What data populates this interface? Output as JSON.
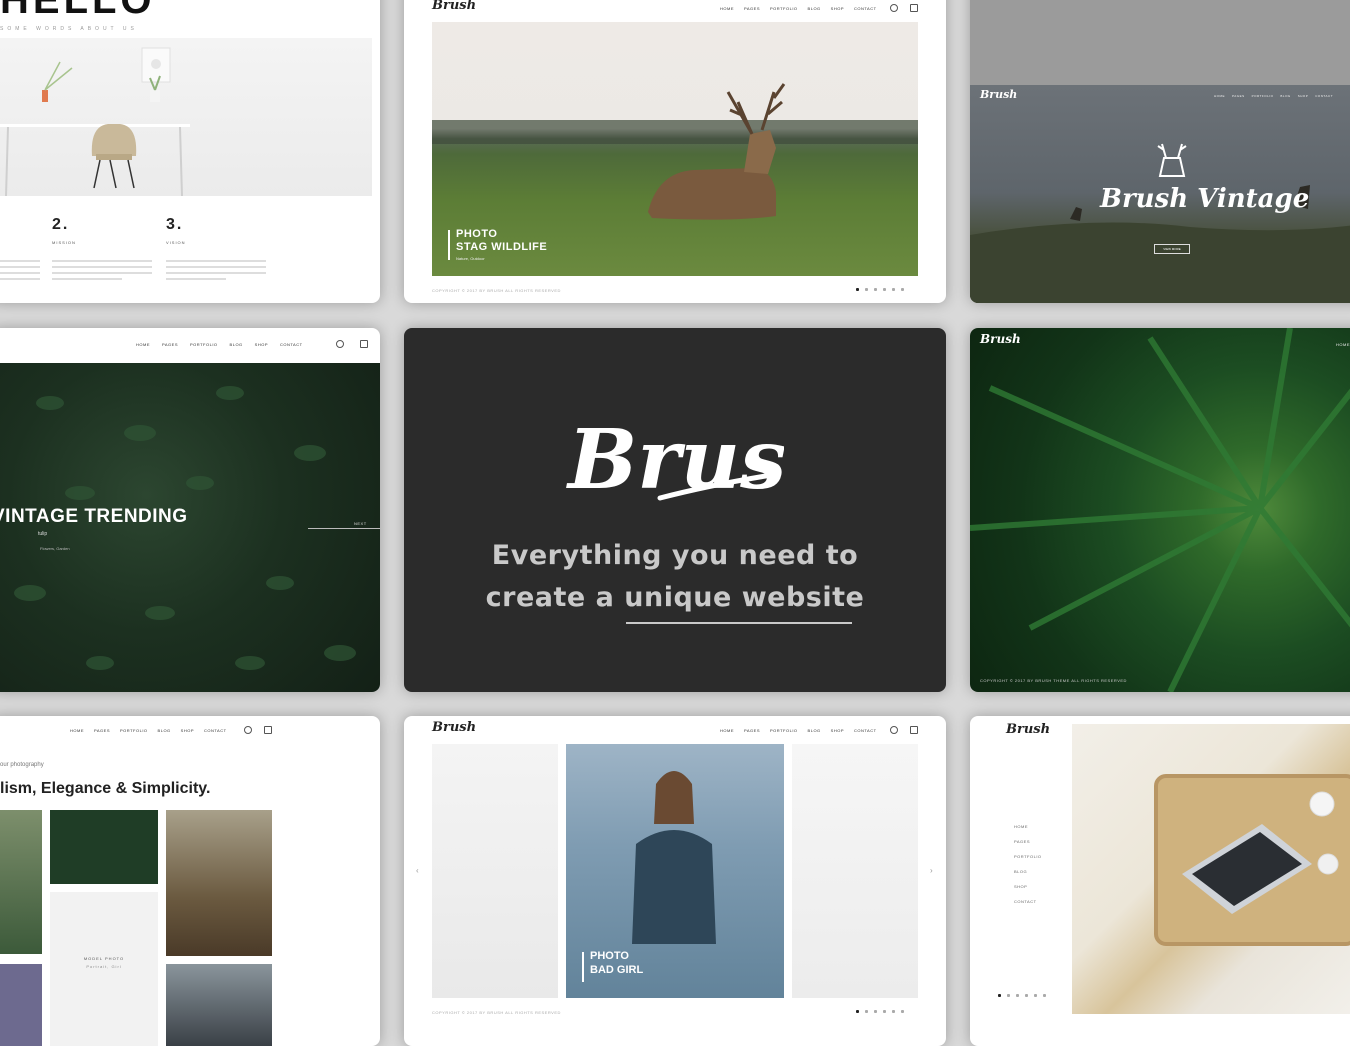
{
  "nav": {
    "items": [
      "HOME",
      "PAGES",
      "PORTFOLIO",
      "BLOG",
      "SHOP",
      "CONTACT"
    ],
    "short_items": [
      "HOME",
      "PAGES",
      "PORTFOLIO",
      "BLOG"
    ]
  },
  "logo_small": "Brush",
  "card1": {
    "headline": "HELLO",
    "subline": "SOME WORDS ABOUT US",
    "col2_number": "2.",
    "col2_label": "MISSION",
    "col3_number": "3.",
    "col3_label": "VISION"
  },
  "card2": {
    "photo_title_1": "PHOTO",
    "photo_title_2": "STAG WILDLIFE",
    "photo_sub": "Nature, Outdoor",
    "copyright": "COPYRIGHT © 2017 BY BRUSH ALL RIGHTS RESERVED"
  },
  "card3": {
    "title": "Brush Vintage",
    "button": "VIEW MORE"
  },
  "card4": {
    "title": "VINTAGE TRENDING",
    "sub": "tulip",
    "sub2": "Flowers, Garden",
    "side_link": "NEXT"
  },
  "center": {
    "logo": "Brush",
    "tagline_line1": "Everything you need to",
    "tagline_line2": "create a unique website"
  },
  "card6": {
    "nav_label": "HOME",
    "copyright": "COPYRIGHT © 2017 BY BRUSH THEME ALL RIGHTS RESERVED"
  },
  "card7": {
    "pre": "our photography",
    "headline": "lism, Elegance & Simplicity.",
    "model_title": "MODEL PHOTO",
    "model_sub": "Portrait, Girl"
  },
  "card8": {
    "photo_title_1": "PHOTO",
    "photo_title_2": "BAD GIRL",
    "copyright": "COPYRIGHT © 2017 BY BRUSH ALL RIGHTS RESERVED"
  },
  "card9": {
    "menu": [
      "HOME",
      "PAGES",
      "PORTFOLIO",
      "BLOG",
      "SHOP",
      "CONTACT"
    ]
  },
  "colors": {
    "background": "#d9d9d9",
    "center_card": "#2b2b2b",
    "tagline": "#c9c9c9"
  }
}
